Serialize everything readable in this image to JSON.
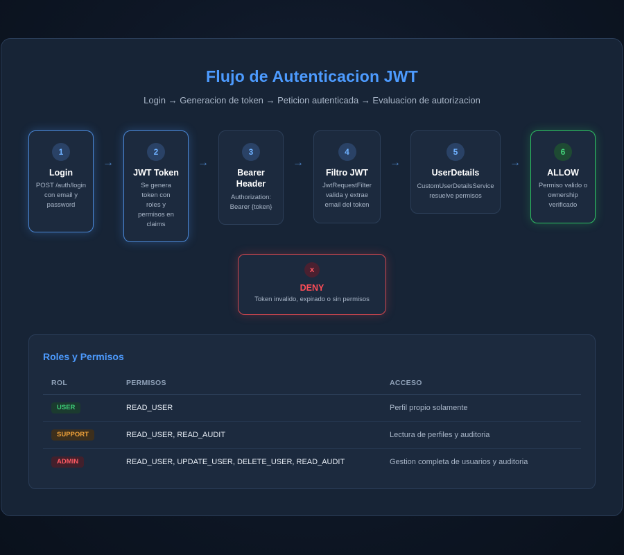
{
  "header": {
    "title": "Flujo de Autenticacion JWT",
    "subtitle": "Login → Generacion de token → Peticion autenticada → Evaluacion de autorizacion"
  },
  "flow": {
    "arrow": "→",
    "steps": [
      {
        "number": "1",
        "title": "Login",
        "description": "POST /auth/login con email y password"
      },
      {
        "number": "2",
        "title": "JWT Token",
        "description": "Se genera token con roles y permisos en claims"
      },
      {
        "number": "3",
        "title": "Bearer Header",
        "description": "Authorization: Bearer {token}"
      },
      {
        "number": "4",
        "title": "Filtro JWT",
        "description": "JwtRequestFilter valida y extrae email del token"
      },
      {
        "number": "5",
        "title": "UserDetails",
        "description": "CustomUserDetailsService resuelve permisos"
      },
      {
        "number": "6",
        "title": "ALLOW",
        "description": "Permiso valido o ownership verificado"
      }
    ],
    "deny": {
      "badge": "x",
      "title": "DENY",
      "description": "Token invalido, expirado o sin permisos"
    }
  },
  "roles": {
    "title": "Roles y Permisos",
    "headers": {
      "role": "ROL",
      "permissions": "PERMISOS",
      "access": "ACCESO"
    },
    "rows": [
      {
        "role": "USER",
        "permissions": "READ_USER",
        "access": "Perfil propio solamente"
      },
      {
        "role": "SUPPORT",
        "permissions": "READ_USER, READ_AUDIT",
        "access": "Lectura de perfiles y auditoria"
      },
      {
        "role": "ADMIN",
        "permissions": "READ_USER, UPDATE_USER, DELETE_USER, READ_AUDIT",
        "access": "Gestion completa de usuarios y auditoria"
      }
    ]
  },
  "colors": {
    "accent": "#4d9bff",
    "allow": "#2fbf63",
    "deny": "#ff4d57",
    "support": "#f2a33a"
  }
}
